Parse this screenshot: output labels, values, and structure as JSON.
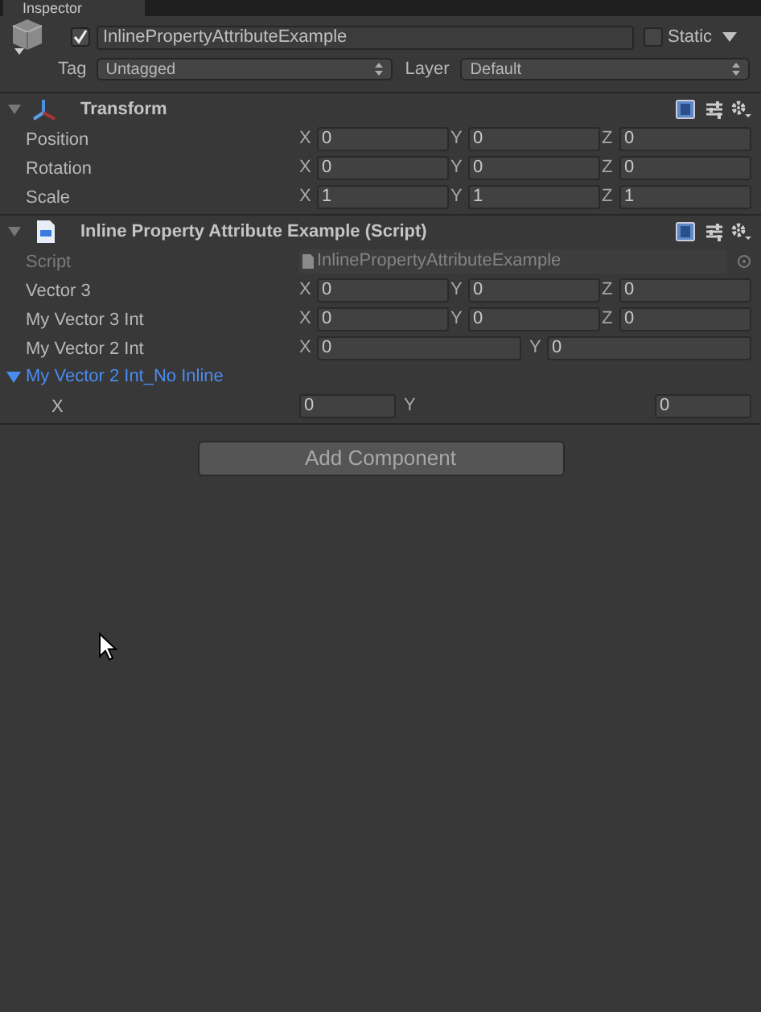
{
  "tab": {
    "label": "Inspector",
    "selected": true
  },
  "object": {
    "active": true,
    "name": "InlinePropertyAttributeExample",
    "static": false,
    "static_label": "Static",
    "tag_label": "Tag",
    "tag": "Untagged",
    "layer_label": "Layer",
    "layer": "Default"
  },
  "components": [
    {
      "kind": "transform",
      "title": "Transform",
      "expanded": true,
      "rows": [
        {
          "kind": "vector3",
          "label": "Position",
          "fields": [
            {
              "axis": "X",
              "value": "0"
            },
            {
              "axis": "Y",
              "value": "0"
            },
            {
              "axis": "Z",
              "value": "0"
            }
          ]
        },
        {
          "kind": "vector3",
          "label": "Rotation",
          "fields": [
            {
              "axis": "X",
              "value": "0"
            },
            {
              "axis": "Y",
              "value": "0"
            },
            {
              "axis": "Z",
              "value": "0"
            }
          ]
        },
        {
          "kind": "vector3",
          "label": "Scale",
          "fields": [
            {
              "axis": "X",
              "value": "1"
            },
            {
              "axis": "Y",
              "value": "1"
            },
            {
              "axis": "Z",
              "value": "1"
            }
          ]
        }
      ]
    },
    {
      "kind": "script",
      "title": "Inline Property Attribute Example (Script)",
      "expanded": true,
      "rows": [
        {
          "kind": "object",
          "label": "Script",
          "value": "InlinePropertyAttributeExample",
          "disabled": true
        },
        {
          "kind": "vector3",
          "label": "Vector 3",
          "fields": [
            {
              "axis": "X",
              "value": "0"
            },
            {
              "axis": "Y",
              "value": "0"
            },
            {
              "axis": "Z",
              "value": "0"
            }
          ]
        },
        {
          "kind": "vector3",
          "label": "My Vector 3 Int",
          "fields": [
            {
              "axis": "X",
              "value": "0"
            },
            {
              "axis": "Y",
              "value": "0"
            },
            {
              "axis": "Z",
              "value": "0"
            }
          ]
        },
        {
          "kind": "vector2",
          "label": "My Vector 2 Int",
          "fields": [
            {
              "axis": "X",
              "value": "0"
            },
            {
              "axis": "Y",
              "value": "0"
            }
          ]
        },
        {
          "kind": "foldout",
          "label": "My Vector 2 Int_No Inline",
          "expanded": true,
          "children": [
            {
              "kind": "split",
              "label": "X",
              "fields": [
                {
                  "value": "0"
                },
                {
                  "axis": "Y",
                  "value": "0"
                }
              ]
            }
          ]
        }
      ]
    }
  ],
  "add_button": "Add Component"
}
